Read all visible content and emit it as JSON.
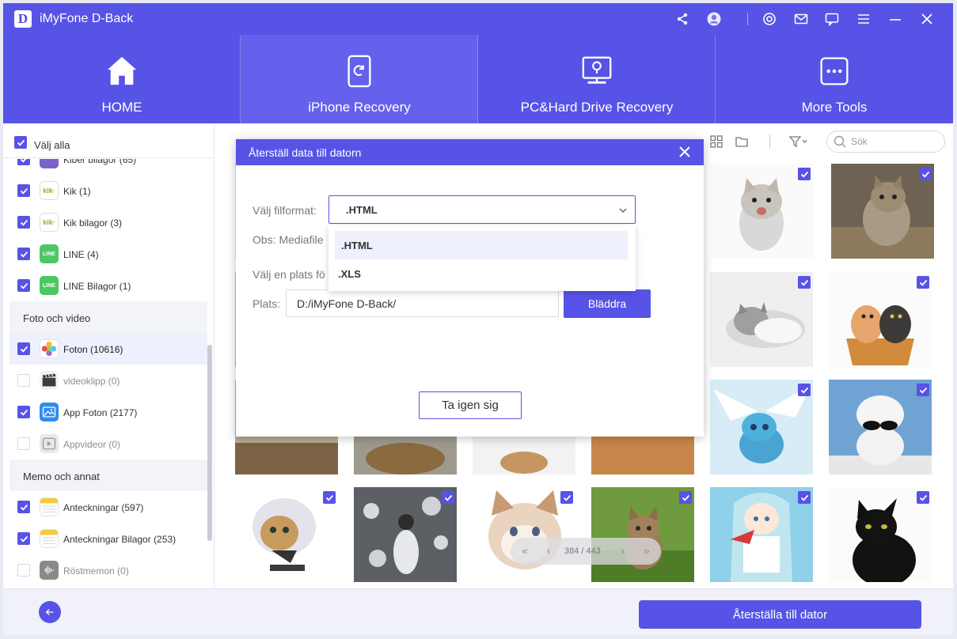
{
  "app": {
    "title": "iMyFone D-Back",
    "logo_letter": "D"
  },
  "nav": {
    "tabs": [
      {
        "label": "HOME"
      },
      {
        "label": "iPhone Recovery"
      },
      {
        "label": "PC&Hard Drive Recovery"
      },
      {
        "label": "More Tools"
      }
    ]
  },
  "sidebar": {
    "select_all": "Välj alla",
    "items": {
      "partial": "Kiber bilagor (65)",
      "kik": "Kik (1)",
      "kik_att": "Kik bilagor (3)",
      "line": "LINE (4)",
      "line_att": "LINE Bilagor (1)",
      "cat_photo": "Foto och video",
      "photos": "Foton (10616)",
      "videos": "videoklipp (0)",
      "app_photos": "App Foton (2177)",
      "app_videos": "Appvideor (0)",
      "cat_memo": "Memo och annat",
      "notes": "Anteckningar (597)",
      "notes_att": "Anteckningar Bilagor (253)",
      "voice": "Röstmemon (0)"
    },
    "icons": {
      "kik_text": "kik·",
      "line_text": "LINE"
    }
  },
  "toolbar": {
    "search_placeholder": "Sök"
  },
  "pager": {
    "text": "384 / 443"
  },
  "bottom": {
    "recover_label": "Återställa till dator"
  },
  "modal": {
    "title": "Återställ data till datorn",
    "format_label": "Välj filformat:",
    "format_value": ".HTML",
    "options": [
      ".HTML",
      ".XLS"
    ],
    "note_label": "Obs: Mediafile",
    "location_label": "Välj en plats fö",
    "path_label": "Plats:",
    "path_value": "D:/iMyFone D-Back/",
    "browse_label": "Bläddra",
    "cancel_label": "Ta igen sig"
  },
  "colors": {
    "accent": "#5753e6",
    "accent_light": "#eef0fd",
    "kik": "#82bc23",
    "line": "#4cc764"
  }
}
